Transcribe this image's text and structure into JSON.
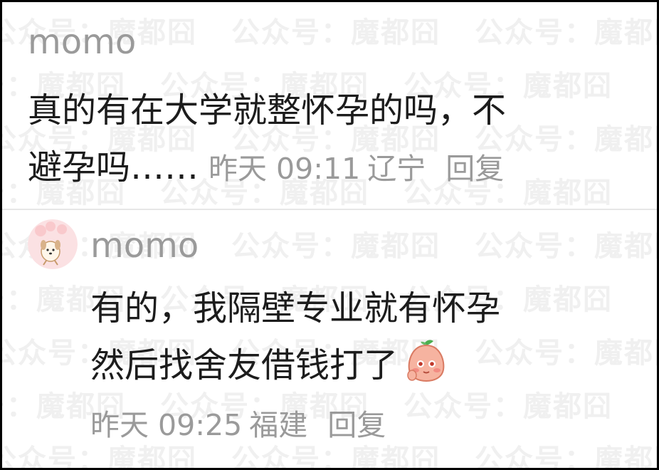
{
  "watermark": {
    "text": "公众号：魔都囧"
  },
  "comments": [
    {
      "username": "momo",
      "line1": "真的有在大学就整怀孕的吗，不",
      "line2": "避孕吗……",
      "time": "昨天 09:11",
      "location": "辽宁",
      "reply": "回复"
    },
    {
      "username": "momo",
      "line1": "有的，我隔壁专业就有怀孕",
      "line2": "然后找舍友借钱打了",
      "time": "昨天 09:25",
      "location": "福建",
      "reply": "回复",
      "emoji": "blushing-peach-emoji",
      "avatar": "cartoon-dog-avatar"
    }
  ],
  "colors": {
    "username": "#9a9a9a",
    "body": "#1c1c1c",
    "meta": "#9a9a9a",
    "watermark": "#f0f0f0",
    "frame": "#000000"
  }
}
